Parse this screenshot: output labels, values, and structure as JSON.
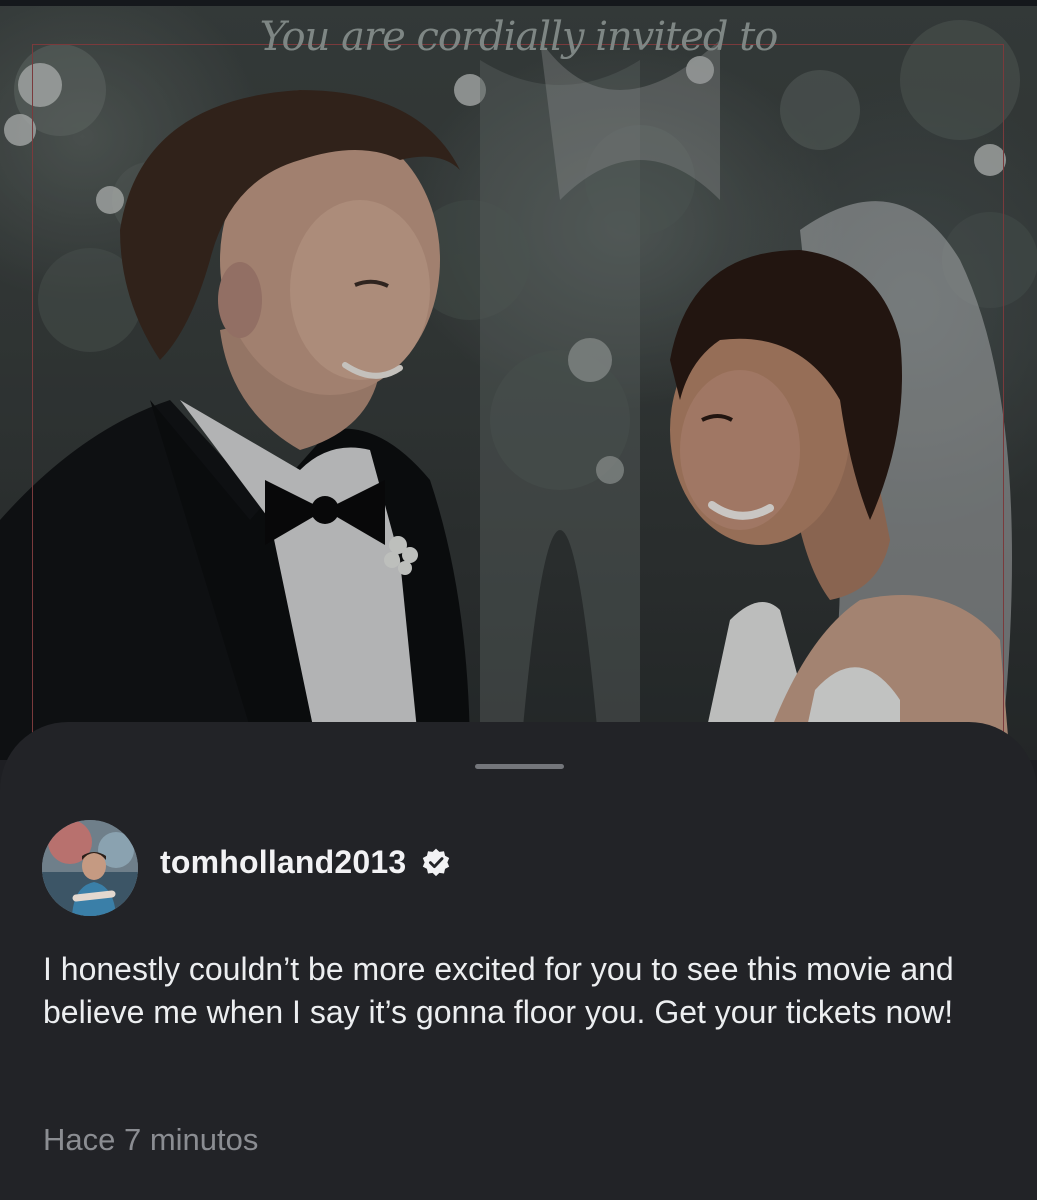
{
  "invitation": {
    "headline": "You are cordially invited to"
  },
  "story_reply": {
    "username": "tomholland2013",
    "verified": true,
    "caption": "I honestly couldn’t be more excited for you to see this movie and believe me when I say it’s gonna floor you. Get your tickets now!",
    "timestamp": "Hace 7 minutos"
  },
  "colors": {
    "sheet_background": "#222327",
    "frame_accent": "#7a3a3c",
    "text_primary": "#f2f2f4",
    "text_secondary": "#8b8d92"
  },
  "icons": {
    "verified": "verified-badge-icon",
    "grabber": "sheet-grabber"
  }
}
